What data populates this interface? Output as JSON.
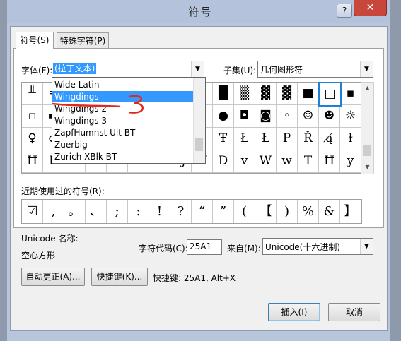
{
  "window": {
    "title": "符号",
    "help_label": "?",
    "close_label": "✕"
  },
  "tabs": [
    {
      "label": "符号(S)"
    },
    {
      "label": "特殊字符(P)"
    }
  ],
  "font": {
    "label": "字体(F):",
    "value": "(拉丁文本)"
  },
  "subset": {
    "label": "子集(U):",
    "value": "几何图形符"
  },
  "font_list": {
    "items": [
      "Wide Latin",
      "Wingdings",
      "Wingdings 2",
      "Wingdings 3",
      "ZapfHumnst Ult BT",
      "Zuerbig",
      "Zurich XBlk BT"
    ],
    "highlighted": "Wingdings"
  },
  "symbol_grid": {
    "rows": [
      [
        "╨",
        "═",
        "",
        "",
        "",
        "",
        "",
        "",
        "",
        "█",
        "▒",
        "▓",
        "▓",
        "■",
        "□",
        "▪"
      ],
      [
        "▫",
        "▬",
        "",
        "",
        "",
        "",
        "",
        "",
        "",
        "●",
        "◘",
        "◙",
        "◦",
        "☺",
        "☻",
        "☼"
      ],
      [
        "♀",
        "♂",
        "",
        "",
        "",
        "",
        "",
        "",
        "",
        "Ŧ",
        "Ł",
        "Ł",
        "P",
        "Ř",
        "ą̸",
        "ɫ"
      ],
      [
        "Ħ",
        "Ř",
        "K",
        "K",
        "Z",
        "Z",
        "G",
        "Ŋ",
        "V",
        "D",
        "v",
        "W",
        "w",
        "Ŧ",
        "Ħ",
        "y"
      ]
    ],
    "selected": "□"
  },
  "recent": {
    "label": "近期使用过的符号(R):",
    "symbols": [
      "☑",
      ",",
      "。",
      "、",
      ";",
      ":",
      "!",
      "?",
      "“",
      "”",
      "(",
      "【",
      ")",
      "%",
      "&",
      "】"
    ]
  },
  "unicode_name": {
    "label": "Unicode 名称:",
    "value": "空心方形"
  },
  "char_code": {
    "label": "字符代码(C):",
    "value": "25A1"
  },
  "from": {
    "label": "来自(M):",
    "value": "Unicode(十六进制)"
  },
  "buttons": {
    "autocorrect": "自动更正(A)...",
    "shortcut_key": "快捷键(K)...",
    "insert": "插入(I)",
    "cancel": "取消"
  },
  "shortcut_text": "快捷键: 25A1, Alt+X",
  "annotation": {
    "text": "3",
    "color": "#e0281e"
  }
}
